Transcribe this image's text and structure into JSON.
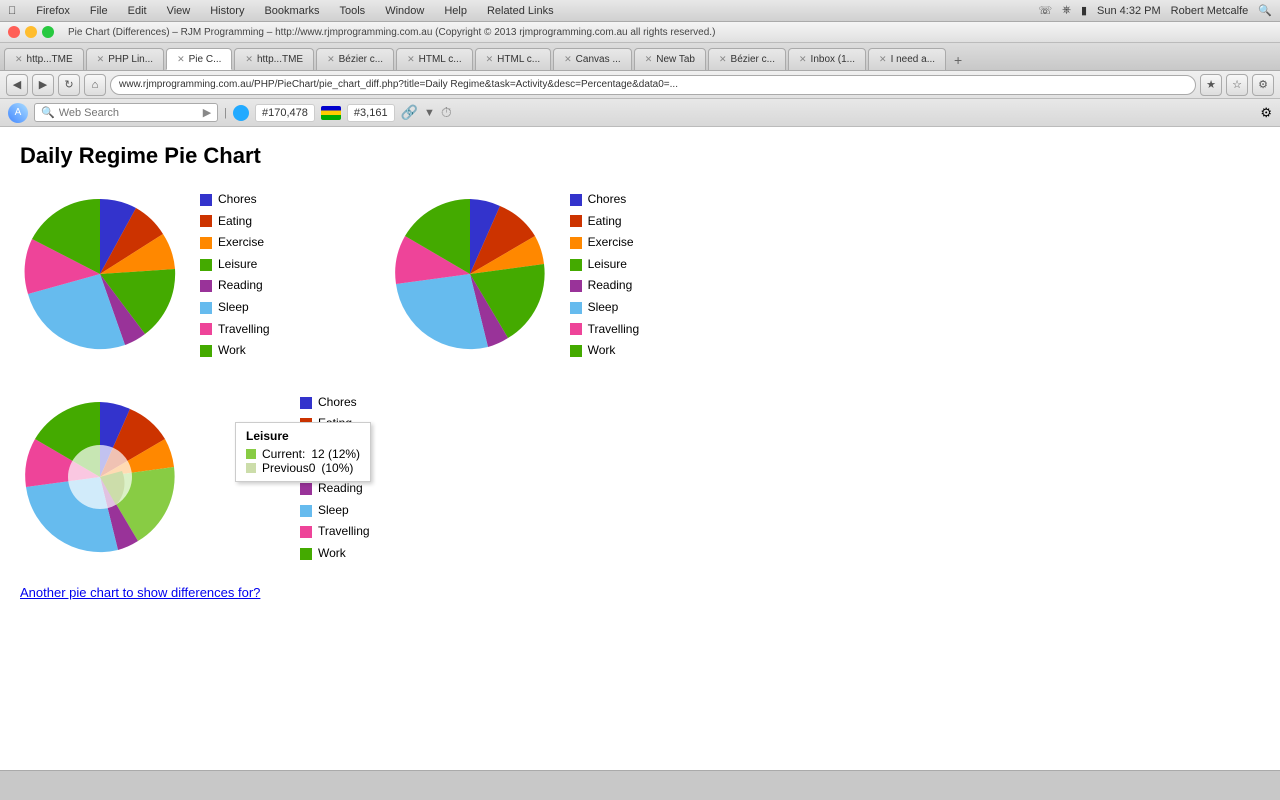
{
  "os": {
    "menubar": {
      "apple": "&#63743;",
      "items": [
        "Firefox",
        "File",
        "Edit",
        "View",
        "History",
        "Bookmarks",
        "Tools",
        "Window",
        "Help",
        "Related Links"
      ],
      "time": "Sun 4:32 PM",
      "user": "Robert Metcalfe"
    }
  },
  "window": {
    "title": "Pie Chart (Differences) – RJM Programming – http://www.rjmprogramming.com.au (Copyright © 2013 rjmprogramming.com.au all rights reserved.)",
    "tabs": [
      {
        "label": "http...TME",
        "active": false
      },
      {
        "label": "PHP Lin...",
        "active": false
      },
      {
        "label": "Pie C...",
        "active": true
      },
      {
        "label": "http...TME",
        "active": false
      },
      {
        "label": "Bézier c...",
        "active": false
      },
      {
        "label": "HTML c...",
        "active": false
      },
      {
        "label": "HTML c...",
        "active": false
      },
      {
        "label": "Canvas ...",
        "active": false
      },
      {
        "label": "New Tab",
        "active": false
      },
      {
        "label": "Bézier c...",
        "active": false
      },
      {
        "label": "Inbox (1...",
        "active": false
      },
      {
        "label": "I need a...",
        "active": false
      }
    ]
  },
  "navbar": {
    "address": "www.rjmprogramming.com.au/PHP/PieChart/pie_chart_diff.php?title=Daily Regime&task=Activity&desc=Percentage&data0=..."
  },
  "searchbar": {
    "placeholder": "Web Search",
    "rank1_label": "#170,478",
    "rank2_label": "#3,161"
  },
  "page": {
    "title": "Daily Regime Pie Chart"
  },
  "legend_items": [
    {
      "label": "Chores",
      "color": "#3333cc"
    },
    {
      "label": "Eating",
      "color": "#cc3300"
    },
    {
      "label": "Exercise",
      "color": "#ff8800"
    },
    {
      "label": "Leisure",
      "color": "#33aa33"
    },
    {
      "label": "Reading",
      "color": "#993399"
    },
    {
      "label": "Sleep",
      "color": "#66bbee"
    },
    {
      "label": "Travelling",
      "color": "#ee4499"
    },
    {
      "label": "Work",
      "color": "#44aa00"
    }
  ],
  "chart1": {
    "segments": [
      {
        "label": "Chores",
        "color": "#3333cc",
        "pct": 8
      },
      {
        "label": "Eating",
        "color": "#cc3300",
        "pct": 7
      },
      {
        "label": "Exercise",
        "color": "#ff8800",
        "pct": 6
      },
      {
        "label": "Leisure",
        "color": "#44aa00",
        "pct": 18
      },
      {
        "label": "Reading",
        "color": "#993399",
        "pct": 5
      },
      {
        "label": "Sleep",
        "color": "#66bbee",
        "pct": 28
      },
      {
        "label": "Travelling",
        "color": "#ee4499",
        "pct": 8
      },
      {
        "label": "Work",
        "color": "#44aa00",
        "pct": 20
      }
    ]
  },
  "chart2": {
    "segments": [
      {
        "label": "Chores",
        "color": "#3333cc",
        "pct": 7
      },
      {
        "label": "Eating",
        "color": "#cc3300",
        "pct": 8
      },
      {
        "label": "Exercise",
        "color": "#ff8800",
        "pct": 7
      },
      {
        "label": "Leisure",
        "color": "#44aa00",
        "pct": 15
      },
      {
        "label": "Reading",
        "color": "#993399",
        "pct": 6
      },
      {
        "label": "Sleep",
        "color": "#66bbee",
        "pct": 30
      },
      {
        "label": "Travelling",
        "color": "#ee4499",
        "pct": 7
      },
      {
        "label": "Work",
        "color": "#44aa00",
        "pct": 20
      }
    ]
  },
  "chart3": {
    "segments": [
      {
        "label": "Chores",
        "color": "#3333cc",
        "pct": 8
      },
      {
        "label": "Eating",
        "color": "#cc3300",
        "pct": 7
      },
      {
        "label": "Exercise",
        "color": "#ff8800",
        "pct": 6
      },
      {
        "label": "Leisure",
        "color": "#88cc44",
        "pct": 12
      },
      {
        "label": "Reading",
        "color": "#993399",
        "pct": 5
      },
      {
        "label": "Sleep",
        "color": "#66bbee",
        "pct": 28
      },
      {
        "label": "Travelling",
        "color": "#ee4499",
        "pct": 8
      },
      {
        "label": "Work",
        "color": "#44aa00",
        "pct": 20
      }
    ]
  },
  "tooltip": {
    "title": "Leisure",
    "rows": [
      {
        "label": "Current:",
        "value": "12 (12%)",
        "color": "#88cc44"
      },
      {
        "label": "Previous0",
        "value": "(10%)",
        "color": "#ccddaa"
      }
    ]
  },
  "footer_link": "Another pie chart to show differences for?"
}
